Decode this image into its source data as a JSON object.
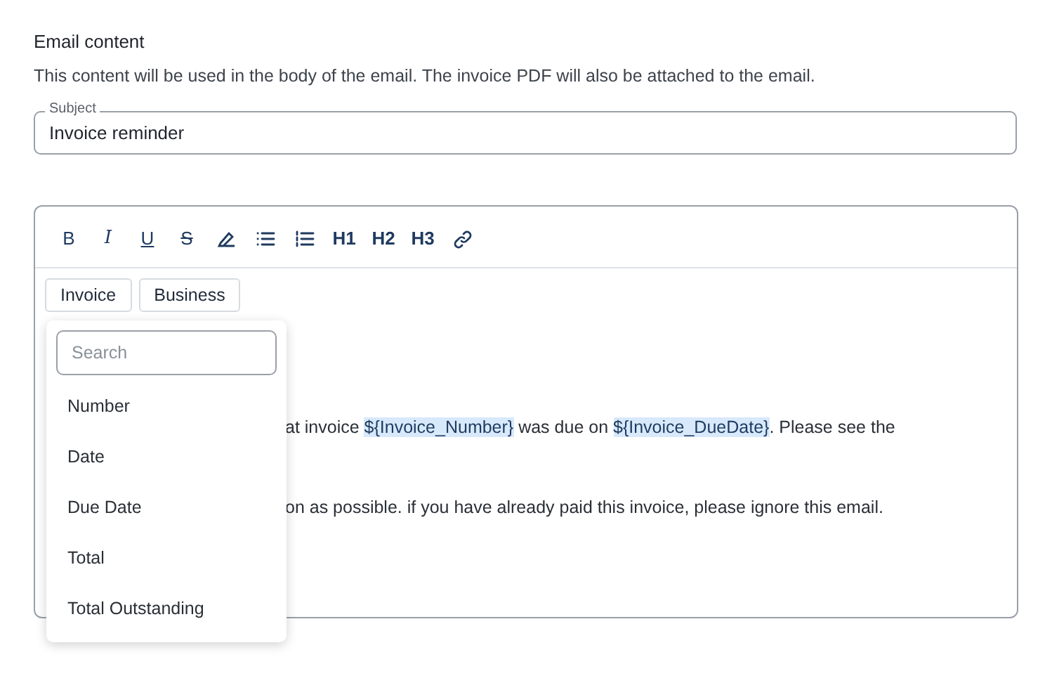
{
  "section": {
    "title": "Email content",
    "description": "This content will be used in the body of the email. The invoice PDF will also be attached to the email."
  },
  "subject": {
    "label": "Subject",
    "value": "Invoice reminder"
  },
  "toolbar": [
    {
      "kind": "text",
      "label": "B"
    },
    {
      "kind": "text",
      "label": "I"
    },
    {
      "kind": "text",
      "label": "U"
    },
    {
      "kind": "text",
      "label": "S"
    },
    {
      "kind": "icon"
    },
    {
      "kind": "icon"
    },
    {
      "kind": "icon"
    },
    {
      "kind": "text",
      "label": "H1"
    },
    {
      "kind": "text",
      "label": "H2"
    },
    {
      "kind": "text",
      "label": "H3"
    },
    {
      "kind": "icon"
    }
  ],
  "variable_groups": [
    {
      "label": "Invoice"
    },
    {
      "label": "Business"
    }
  ],
  "dropdown": {
    "search_placeholder": "Search",
    "items": [
      "Number",
      "Date",
      "Due Date",
      "Total",
      "Total Outstanding"
    ]
  },
  "body_lines": [
    [
      {
        "kind": "text",
        "text": "at invoice "
      },
      {
        "kind": "variable",
        "text": "${Invoice_Number}"
      },
      {
        "kind": "text",
        "text": " was due on "
      },
      {
        "kind": "variable",
        "text": "${Invoice_DueDate}"
      },
      {
        "kind": "text",
        "text": ". Please see the"
      }
    ],
    [
      {
        "kind": "text",
        "text": "on as possible. if you have already paid this invoice, please ignore this email."
      }
    ]
  ]
}
